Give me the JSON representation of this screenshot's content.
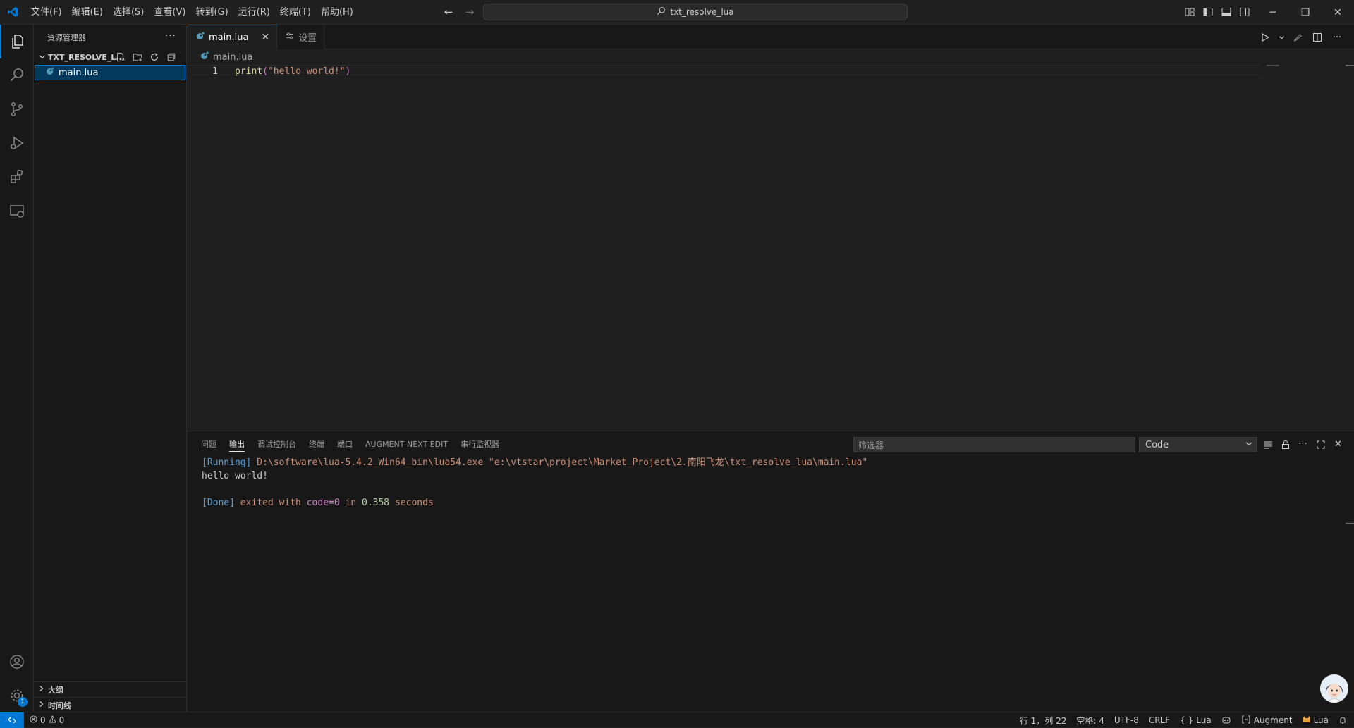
{
  "menu": [
    "文件(F)",
    "编辑(E)",
    "选择(S)",
    "查看(V)",
    "转到(G)",
    "运行(R)",
    "终端(T)",
    "帮助(H)"
  ],
  "command_center": {
    "label": "txt_resolve_lua"
  },
  "sidebar": {
    "title": "资源管理器",
    "folder": "TXT_RESOLVE_L...",
    "files": [
      {
        "name": "main.lua"
      }
    ],
    "sections": [
      "大纲",
      "时间线"
    ]
  },
  "editor": {
    "tabs": [
      {
        "label": "main.lua",
        "active": true
      },
      {
        "label": "设置",
        "active": false
      }
    ],
    "breadcrumb": "main.lua",
    "lines": [
      {
        "number": "1",
        "fn": "print",
        "open": "(",
        "string": "\"hello world!\"",
        "close": ")"
      }
    ]
  },
  "panel": {
    "tabs": [
      "问题",
      "输出",
      "调试控制台",
      "终端",
      "端口",
      "AUGMENT NEXT EDIT",
      "串行监视器"
    ],
    "active_tab": "输出",
    "filter_placeholder": "筛选器",
    "channel": "Code",
    "output": {
      "running_tag": "[Running]",
      "running_cmd": " D:\\software\\lua-5.4.2_Win64_bin\\lua54.exe \"e:\\vtstar\\project\\Market_Project\\2.南阳飞龙\\txt_resolve_lua\\main.lua\"",
      "result": "hello world!",
      "done_tag": "[Done]",
      "done_exited": " exited with ",
      "done_code": "code=0",
      "done_in": " in ",
      "done_time": "0.358",
      "done_seconds": " seconds"
    }
  },
  "activity": {
    "settings_badge": "1"
  },
  "status": {
    "errors": "0",
    "warnings": "0",
    "position": "行 1，列 22",
    "spaces": "空格: 4",
    "encoding": "UTF-8",
    "eol": "CRLF",
    "language": "Lua",
    "augment": "Augment",
    "lua_ext": "Lua"
  },
  "colors": {
    "accent": "#0078d4",
    "background": "#1f1f1f",
    "sidebar": "#181818"
  }
}
